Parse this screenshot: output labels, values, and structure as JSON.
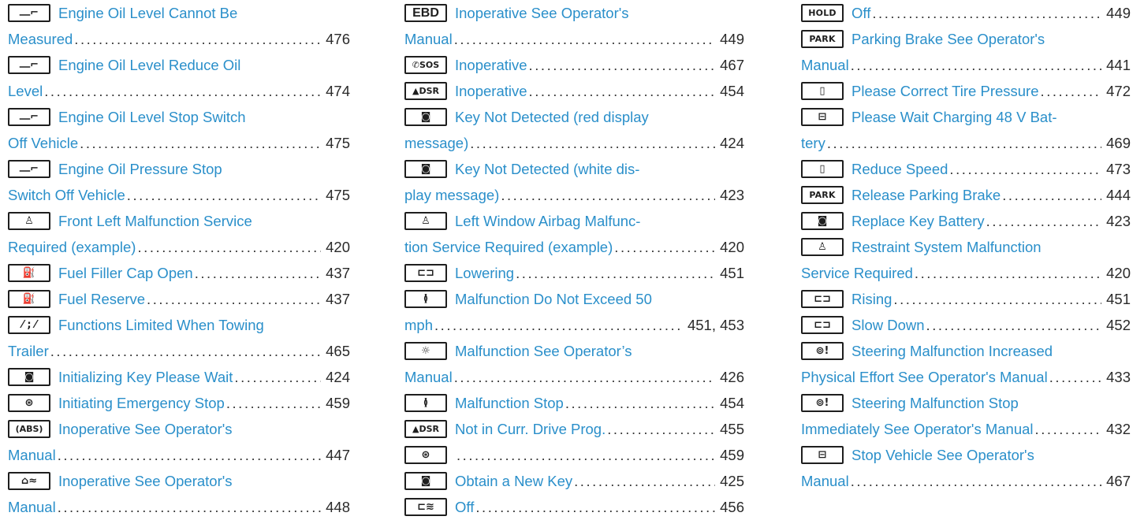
{
  "columns": [
    {
      "entries": [
        {
          "icon": "engine-oil-icon",
          "glyph": "⎼⌐",
          "lines": [
            "Engine Oil Level Cannot Be",
            "Measured"
          ],
          "page": "476"
        },
        {
          "icon": "engine-oil-icon",
          "glyph": "⎼⌐",
          "lines": [
            "Engine Oil Level Reduce Oil",
            "Level"
          ],
          "page": "474"
        },
        {
          "icon": "engine-oil-icon",
          "glyph": "⎼⌐",
          "lines": [
            "Engine Oil Level Stop Switch",
            "Off Vehicle"
          ],
          "page": "475"
        },
        {
          "icon": "engine-oil-icon",
          "glyph": "⎼⌐",
          "lines": [
            "Engine Oil Pressure Stop",
            "Switch Off Vehicle"
          ],
          "page": "475"
        },
        {
          "icon": "airbag-icon",
          "glyph": "♙",
          "lines": [
            "Front Left Malfunction Service",
            "Required (example)"
          ],
          "page": "420"
        },
        {
          "icon": "fuel-pump-icon",
          "glyph": "⛽",
          "lines": [
            "Fuel Filler Cap Open"
          ],
          "page": "437"
        },
        {
          "icon": "fuel-pump-icon",
          "glyph": "⛽",
          "lines": [
            "Fuel Reserve"
          ],
          "page": "437"
        },
        {
          "icon": "towing-trailer-icon",
          "glyph": "⁄ ; ⁄",
          "lines": [
            "Functions Limited When Towing",
            "Trailer"
          ],
          "page": "465"
        },
        {
          "icon": "key-icon",
          "glyph": "◙",
          "lines": [
            "Initializing Key Please Wait"
          ],
          "page": "424"
        },
        {
          "icon": "emergency-stop-icon",
          "glyph": "⊛",
          "lines": [
            "Initiating Emergency Stop"
          ],
          "page": "459"
        },
        {
          "icon": "abs-icon",
          "glyph": "(ABS)",
          "lines": [
            "Inoperative See Operator's",
            "Manual"
          ],
          "page": "447"
        },
        {
          "icon": "skid-icon",
          "glyph": "⌂≈",
          "lines": [
            "Inoperative See Operator's",
            "Manual"
          ],
          "page": "448"
        }
      ]
    },
    {
      "entries": [
        {
          "icon": "ebd-icon",
          "glyph": "EBD",
          "lines": [
            "Inoperative See Operator's",
            "Manual"
          ],
          "page": "449"
        },
        {
          "icon": "sos-icon",
          "glyph": "✆SOS",
          "lines": [
            "Inoperative"
          ],
          "page": "467"
        },
        {
          "icon": "dsr-icon",
          "glyph": "▲DSR",
          "lines": [
            "Inoperative"
          ],
          "page": "454"
        },
        {
          "icon": "key-icon",
          "glyph": "◙",
          "lines": [
            "Key Not Detected  (red display",
            "message)"
          ],
          "page": "424"
        },
        {
          "icon": "key-icon",
          "glyph": "◙",
          "lines": [
            "Key Not Detected  (white dis-",
            "play message)"
          ],
          "page": "423"
        },
        {
          "icon": "airbag-icon",
          "glyph": "♙",
          "lines": [
            "Left Window Airbag Malfunc-",
            "tion Service Required (example)"
          ],
          "page": "420"
        },
        {
          "icon": "vehicle-level-icon",
          "glyph": "⊏⊐",
          "lines": [
            "Lowering"
          ],
          "page": "451"
        },
        {
          "icon": "suspension-icon",
          "glyph": "≬",
          "lines": [
            "Malfunction Do Not Exceed 50",
            "mph"
          ],
          "page": "451, 453"
        },
        {
          "icon": "light-icon",
          "glyph": "☼",
          "lines": [
            "Malfunction See Operator’s",
            "Manual"
          ],
          "page": "426"
        },
        {
          "icon": "suspension-icon",
          "glyph": "≬",
          "lines": [
            "Malfunction Stop"
          ],
          "page": "454"
        },
        {
          "icon": "dsr-icon",
          "glyph": "▲DSR",
          "lines": [
            "Not in Curr. Drive Prog."
          ],
          "page": "455"
        },
        {
          "icon": "emergency-stop-icon",
          "glyph": "⊛",
          "lines": [
            ""
          ],
          "page": "459"
        },
        {
          "icon": "key-icon",
          "glyph": "◙",
          "lines": [
            "Obtain a New Key"
          ],
          "page": "425"
        },
        {
          "icon": "vehicle-off-icon",
          "glyph": "⊏≋",
          "lines": [
            "Off"
          ],
          "page": "456"
        }
      ]
    },
    {
      "entries": [
        {
          "icon": "hold-icon",
          "glyph": "HOLD",
          "lines": [
            "Off"
          ],
          "page": "449"
        },
        {
          "icon": "park-icon",
          "glyph": "PARK",
          "lines": [
            "Parking Brake See Operator's",
            "Manual"
          ],
          "page": "441"
        },
        {
          "icon": "tire-pressure-icon",
          "glyph": "▯",
          "lines": [
            "Please Correct Tire Pressure"
          ],
          "page": "472"
        },
        {
          "icon": "battery-icon",
          "glyph": "⊟",
          "lines": [
            "Please Wait Charging 48 V Bat-",
            "tery"
          ],
          "page": "469"
        },
        {
          "icon": "tire-pressure-icon",
          "glyph": "▯",
          "lines": [
            "Reduce Speed"
          ],
          "page": "473"
        },
        {
          "icon": "park-icon",
          "glyph": "PARK",
          "lines": [
            "Release Parking Brake"
          ],
          "page": "444"
        },
        {
          "icon": "key-icon",
          "glyph": "◙",
          "lines": [
            "Replace Key Battery"
          ],
          "page": "423"
        },
        {
          "icon": "airbag-icon",
          "glyph": "♙",
          "lines": [
            "Restraint System Malfunction",
            "Service Required"
          ],
          "page": "420"
        },
        {
          "icon": "vehicle-level-icon",
          "glyph": "⊏⊐",
          "lines": [
            "Rising"
          ],
          "page": "451"
        },
        {
          "icon": "vehicle-level-icon",
          "glyph": "⊏⊐",
          "lines": [
            "Slow Down"
          ],
          "page": "452"
        },
        {
          "icon": "steering-icon",
          "glyph": "⊚!",
          "lines": [
            "Steering Malfunction Increased",
            "Physical Effort See Operator's Manual"
          ],
          "page": "433"
        },
        {
          "icon": "steering-icon",
          "glyph": "⊚!",
          "lines": [
            "Steering Malfunction Stop",
            "Immediately See Operator's Manual"
          ],
          "page": "432"
        },
        {
          "icon": "battery-icon",
          "glyph": "⊟",
          "lines": [
            "Stop Vehicle See Operator's",
            "Manual"
          ],
          "page": "467"
        }
      ]
    }
  ]
}
